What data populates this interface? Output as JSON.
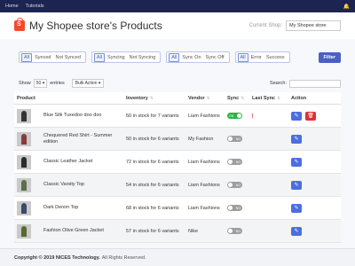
{
  "topnav": {
    "home": "Home",
    "tutorials": "Tutorials",
    "bell_icon": "bell-icon"
  },
  "header": {
    "title": "My Shopee store's Products",
    "shop_label": "Current Shop:",
    "shop_value": "My Shopee store",
    "logo_letter": "S"
  },
  "filters": {
    "sync": [
      "All",
      "Synced",
      "Not Synced"
    ],
    "syncing": [
      "All",
      "Syncing",
      "Not Syncing"
    ],
    "sync_state": [
      "All",
      "Sync On",
      "Sync Off"
    ],
    "result": [
      "All",
      "Error",
      "Success"
    ],
    "filter_button": "Filter"
  },
  "tools": {
    "show": "Show",
    "entries_value": "50",
    "entries": "entries",
    "bulk_action": "Bulk Action",
    "search_label": "Search:"
  },
  "table": {
    "headers": {
      "product": "Product",
      "inventory": "Inventory",
      "vendor": "Vendor",
      "sync": "Sync",
      "last_sync": "Last Sync",
      "action": "Action"
    },
    "rows": [
      {
        "name": "Blue Silk Tuxedoo doo doo",
        "inventory": "50 in stock for 7 variants",
        "vendor": "Liam Fashions",
        "sync": "on",
        "toggle_text": "ON"
      },
      {
        "name": "Chequered Red Shirt - Summer edition",
        "inventory": "50 in stock for 6 variants",
        "vendor": "My Fashion",
        "sync": "off",
        "toggle_text": "NO"
      },
      {
        "name": "Classic Leather Jacket",
        "inventory": "72 in stock for 6 variants",
        "vendor": "Liam Fashions",
        "sync": "off",
        "toggle_text": "NO"
      },
      {
        "name": "Classic Varsity Top",
        "inventory": "54 in stock for 6 variants",
        "vendor": "Liam Fashions",
        "sync": "off",
        "toggle_text": "NO"
      },
      {
        "name": "Dark Denim Top",
        "inventory": "68 in stock for 6 variants",
        "vendor": "Liam Fashions",
        "sync": "off",
        "toggle_text": "NO"
      },
      {
        "name": "Fashion Olive Green Jacket",
        "inventory": "57 in stock for 6 variants",
        "vendor": "Nike",
        "sync": "off",
        "toggle_text": "NO"
      }
    ]
  },
  "footer": {
    "copyright": "Copyright © 2019 NICES Technology.",
    "rights": "All Rights Reserved."
  }
}
